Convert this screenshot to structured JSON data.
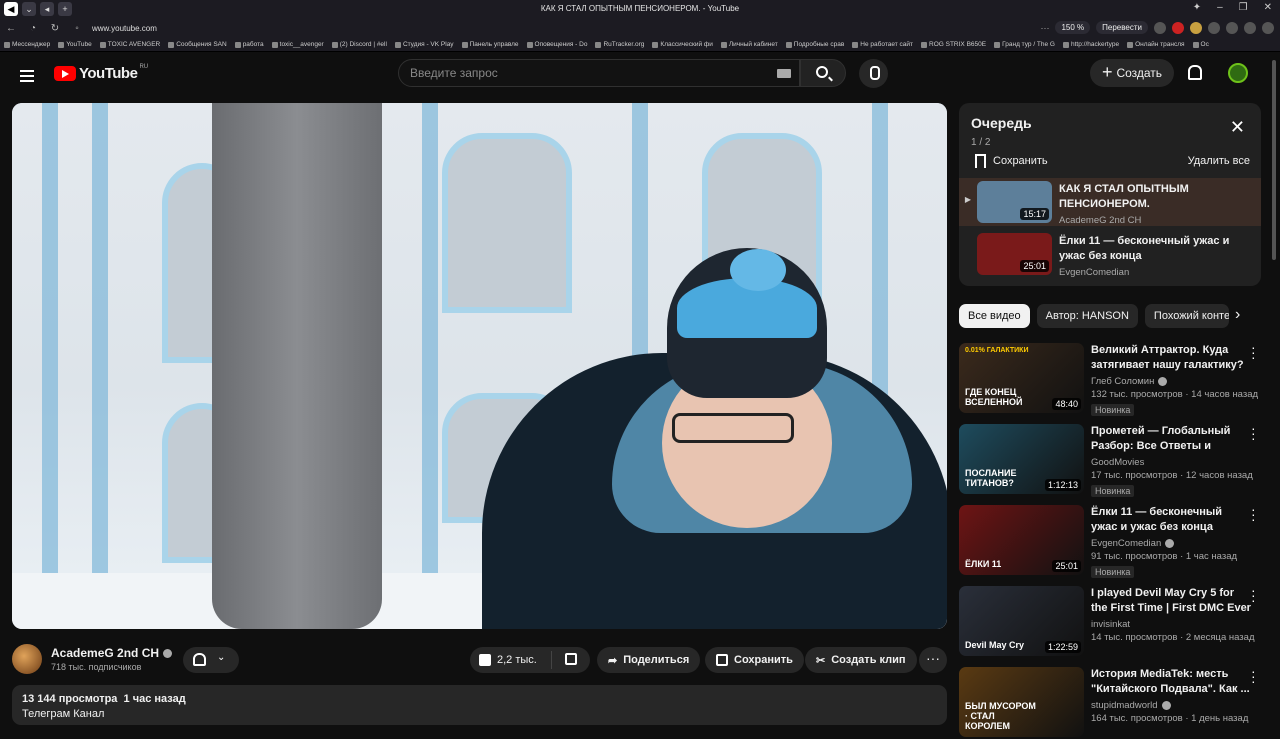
{
  "browser": {
    "tab_title": "КАК Я СТАЛ ОПЫТНЫМ ПЕНСИОНЕРОМ. - YouTube",
    "url": "www.youtube.com",
    "zoom": "150 %",
    "translate": "Перевести",
    "bookmarks": [
      "Мессенджер",
      "YouTube",
      "TOXIC AVENGER",
      "Сообщения SAN",
      "работа",
      "toxic__avenger",
      "(2) Discord | #ell",
      "Студия - VK Play",
      "Панель управле",
      "Оповещения - Do",
      "RuTracker.org",
      "Классический фи",
      "Личный кабинет",
      "Подробные срав",
      "Не работает сайт",
      "ROG STRIX B650E",
      "Гранд тур / The G",
      "http://hackertype",
      "Онлайн трансля",
      "Ос"
    ]
  },
  "header": {
    "logo_text": "YouTube",
    "region": "RU",
    "search_placeholder": "Введите запрос",
    "create_label": "Создать"
  },
  "queue": {
    "title": "Очередь",
    "count": "1 / 2",
    "save_label": "Сохранить",
    "clear_label": "Удалить все",
    "items": [
      {
        "title": "КАК Я СТАЛ ОПЫТНЫМ ПЕНСИОНЕРОМ.",
        "channel": "AcademeG 2nd CH",
        "duration": "15:17",
        "active": true
      },
      {
        "title": "Ёлки 11 — бесконечный ужас и ужас без конца",
        "channel": "EvgenComedian",
        "duration": "25:01",
        "active": false
      }
    ]
  },
  "chips": [
    "Все видео",
    "Автор: HANSON",
    "Похожий конте"
  ],
  "recommendations": [
    {
      "title": "Великий Аттрактор. Куда затягивает нашу галактику? ...",
      "channel": "Глеб Соломин",
      "verified": true,
      "meta": "132 тыс. просмотров · 14 часов назад",
      "badge": "Новинка",
      "duration": "48:40",
      "thumb_text": "ГДЕ КОНЕЦ ВСЕЛЕННОЙ",
      "thumb_top": "0.01% ГАЛАКТИКИ",
      "color": "#3b2a1c"
    },
    {
      "title": "Прометей — Глобальный Разбор: Все Ответы и Тайны...",
      "channel": "GoodMovies",
      "verified": false,
      "meta": "17 тыс. просмотров · 12 часов назад",
      "badge": "Новинка",
      "duration": "1:12:13",
      "thumb_text": "ПОСЛАНИЕ ТИТАНОВ?",
      "thumb_top": "",
      "color": "#1e4c5e"
    },
    {
      "title": "Ёлки 11 — бесконечный ужас и ужас без конца",
      "channel": "EvgenComedian",
      "verified": true,
      "meta": "91 тыс. просмотров · 1 час назад",
      "badge": "Новинка",
      "duration": "25:01",
      "thumb_text": "ЁЛКИ 11",
      "thumb_top": "",
      "color": "#6e1414"
    },
    {
      "title": "I played Devil May Cry 5 for the First Time | First DMC Ever",
      "channel": "invisinkat",
      "verified": false,
      "meta": "14 тыс. просмотров · 2 месяца назад",
      "badge": "",
      "duration": "1:22:59",
      "thumb_text": "Devil May Cry",
      "thumb_top": "",
      "color": "#2a2f3a"
    },
    {
      "title": "История MediaTek: месть \"Китайского Подвала\". Как ...",
      "channel": "stupidmadworld",
      "verified": true,
      "meta": "164 тыс. просмотров · 1 день назад",
      "badge": "",
      "duration": "",
      "thumb_text": "БЫЛ МУСОРОМ · СТАЛ КОРОЛЕМ",
      "thumb_top": "",
      "color": "#5a3a12"
    }
  ],
  "video": {
    "channel": "AcademeG 2nd CH",
    "subscribers": "718 тыс. подписчиков",
    "likes": "2,2 тыс.",
    "share_label": "Поделиться",
    "save_label": "Сохранить",
    "clip_label": "Создать клип",
    "views": "13 144 просмотра",
    "published": "1 час назад",
    "description_line": "Телеграм Канал"
  }
}
